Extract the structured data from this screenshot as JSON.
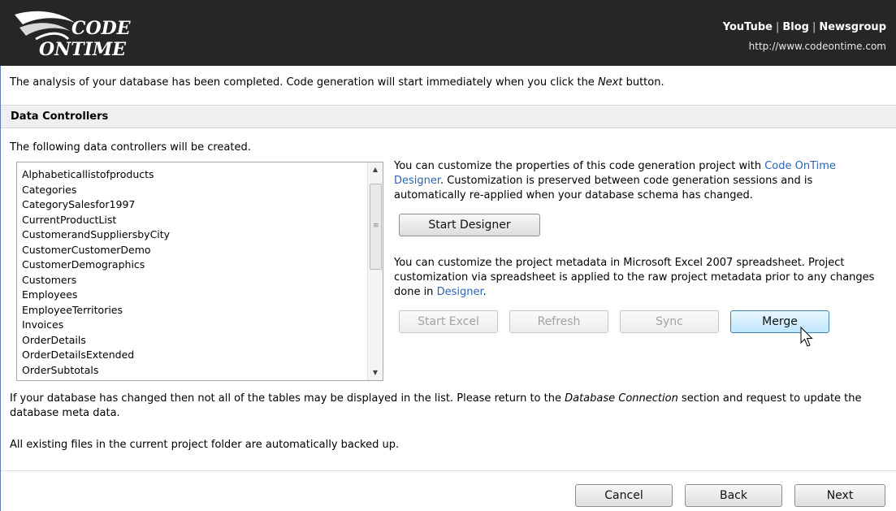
{
  "header": {
    "logo_text_line1": "CODE",
    "logo_text_line2": "ONTIME",
    "links": [
      "YouTube",
      "Blog",
      "Newsgroup"
    ],
    "separator": "|",
    "url": "http://www.codeontime.com"
  },
  "intro": {
    "before": "The analysis of your database has been completed. Code generation will start immediately when you click the ",
    "emphasis": "Next",
    "after": " button."
  },
  "section": {
    "title": "Data Controllers"
  },
  "controllers": {
    "caption": "The following data controllers will be created.",
    "items": [
      "Alphabeticallistofproducts",
      "Categories",
      "CategorySalesfor1997",
      "CurrentProductList",
      "CustomerandSuppliersbyCity",
      "CustomerCustomerDemo",
      "CustomerDemographics",
      "Customers",
      "Employees",
      "EmployeeTerritories",
      "Invoices",
      "OrderDetails",
      "OrderDetailsExtended",
      "OrderSubtotals"
    ]
  },
  "designer": {
    "text_before": "You can customize the properties of this code generation project with ",
    "link": "Code OnTime Designer",
    "text_after": ". Customization is preserved between code generation sessions and is automatically re-applied when your database schema has changed.",
    "start_button": "Start Designer"
  },
  "excel": {
    "text_before": "You can customize the project metadata in Microsoft Excel 2007 spreadsheet. Project customization via spreadsheet is applied to the raw project metadata prior to any changes done in ",
    "link": "Designer",
    "text_after": ".",
    "buttons": {
      "start_excel": "Start Excel",
      "refresh": "Refresh",
      "sync": "Sync",
      "merge": "Merge"
    }
  },
  "notes": {
    "note1_before": "If your database has changed then not all of the tables may be displayed in the list. Please return to the ",
    "note1_emphasis": "Database Connection",
    "note1_after": " section and request to update the database meta data.",
    "note2": "All existing files in the current project folder are automatically backed up."
  },
  "footer": {
    "cancel": "Cancel",
    "back": "Back",
    "next": "Next"
  },
  "colors": {
    "header_bg": "#262626",
    "link": "#2d64b3",
    "section_bg": "#efefef"
  }
}
